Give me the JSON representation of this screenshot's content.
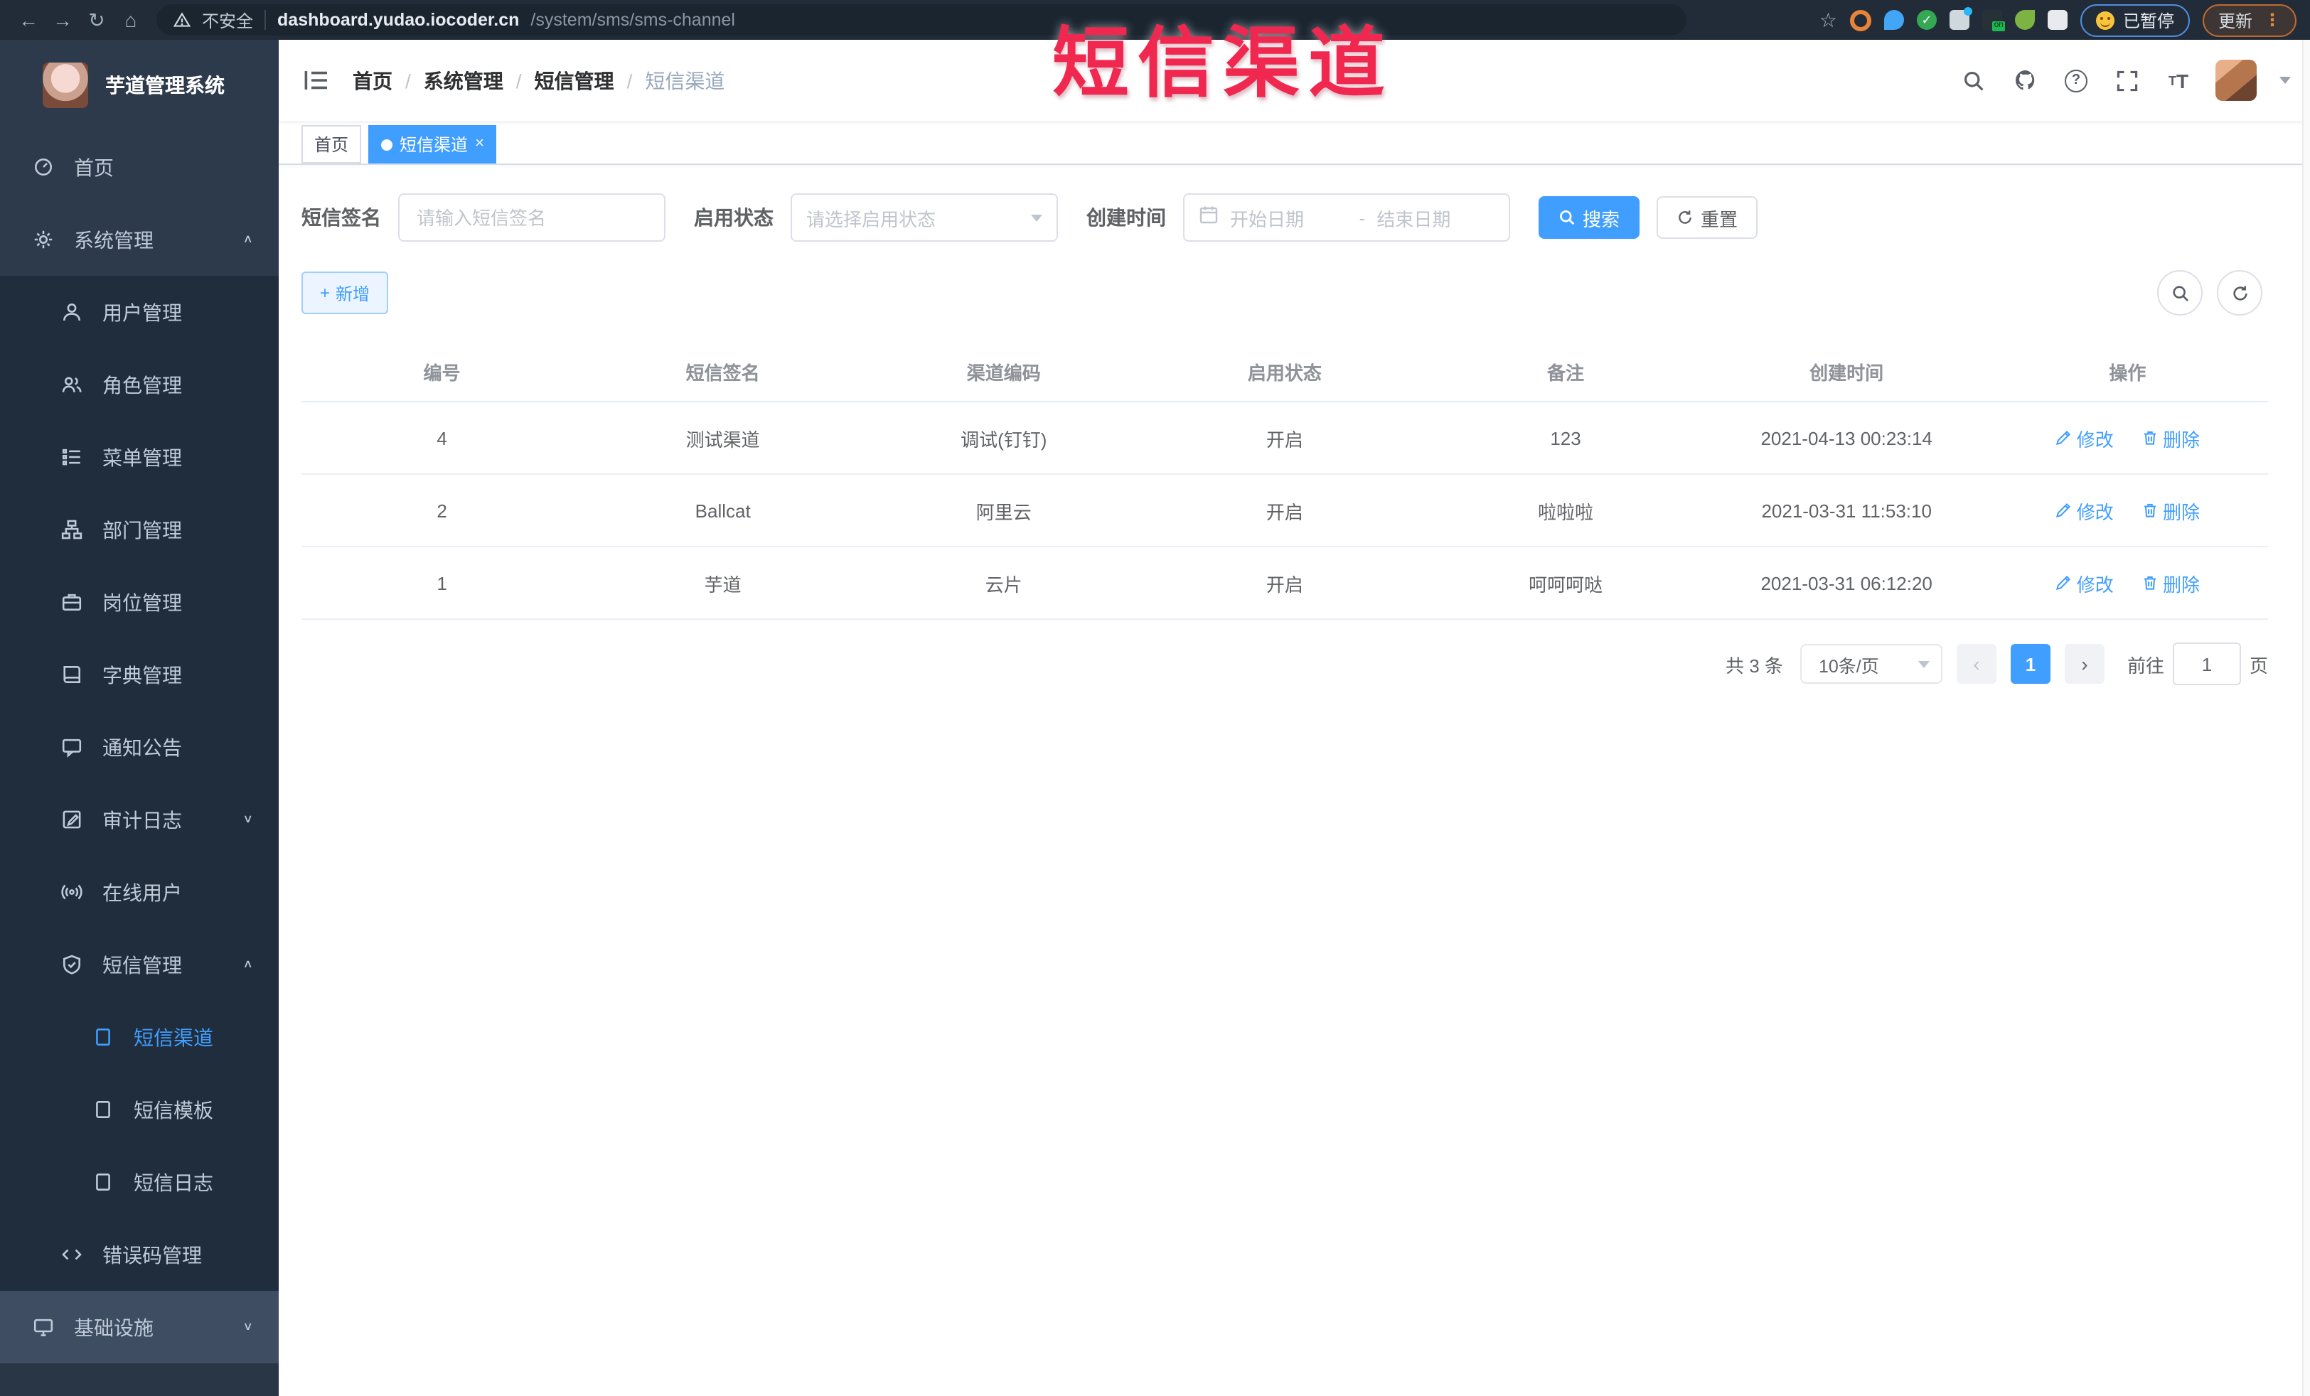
{
  "colors": {
    "accent": "#409eff",
    "overlay": "#f0284f",
    "sidebar": "#2d3a4b",
    "submenu": "#1f2d3d",
    "sidebartext": "#bfcbd9"
  },
  "browser": {
    "security_label": "不安全",
    "url_host": "dashboard.yudao.iocoder.cn",
    "url_path": "/system/sms/sms-channel",
    "paused_badge": "已暂停",
    "update_label": "更新",
    "nav_icons": [
      "back-icon",
      "forward-icon",
      "refresh-icon",
      "home-icon"
    ],
    "extension_icons": [
      "bookmark-star-icon",
      "orange-extension-icon",
      "pin-extension-icon",
      "check-extension-icon",
      "people-extension-icon",
      "dark-on-extension-icon",
      "sprout-extension-icon",
      "puzzle-extension-icon"
    ]
  },
  "overlay": {
    "text": "短信渠道"
  },
  "sidebar": {
    "title": "芋道管理系统",
    "items": [
      {
        "id": "home",
        "label": "首页",
        "icon": "dashboard-icon",
        "level": 1
      },
      {
        "id": "system",
        "label": "系统管理",
        "icon": "gear-icon",
        "level": 1,
        "arrow": "up"
      },
      {
        "id": "users",
        "label": "用户管理",
        "icon": "user-icon",
        "level": 2
      },
      {
        "id": "roles",
        "label": "角色管理",
        "icon": "users-icon",
        "level": 2
      },
      {
        "id": "menus",
        "label": "菜单管理",
        "icon": "menu-list-icon",
        "level": 2
      },
      {
        "id": "depts",
        "label": "部门管理",
        "icon": "tree-icon",
        "level": 2
      },
      {
        "id": "posts",
        "label": "岗位管理",
        "icon": "briefcase-icon",
        "level": 2
      },
      {
        "id": "dicts",
        "label": "字典管理",
        "icon": "book-icon",
        "level": 2
      },
      {
        "id": "notices",
        "label": "通知公告",
        "icon": "message-icon",
        "level": 2
      },
      {
        "id": "auditlog",
        "label": "审计日志",
        "icon": "log-icon",
        "level": 2,
        "arrow": "down"
      },
      {
        "id": "online",
        "label": "在线用户",
        "icon": "online-icon",
        "level": 2
      },
      {
        "id": "sms",
        "label": "短信管理",
        "icon": "shield-icon",
        "level": 2,
        "arrow": "up"
      },
      {
        "id": "sms-channel",
        "label": "短信渠道",
        "icon": "doc-icon",
        "level": 3,
        "active": true
      },
      {
        "id": "sms-template",
        "label": "短信模板",
        "icon": "doc-icon",
        "level": 3
      },
      {
        "id": "sms-log",
        "label": "短信日志",
        "icon": "doc-icon",
        "level": 3
      },
      {
        "id": "errcode",
        "label": "错误码管理",
        "icon": "code-icon",
        "level": 2
      },
      {
        "id": "infra",
        "label": "基础设施",
        "icon": "infra-icon",
        "level": 1,
        "arrow": "down",
        "variant": "light"
      }
    ]
  },
  "header": {
    "breadcrumb": [
      "首页",
      "系统管理",
      "短信管理",
      "短信渠道"
    ],
    "breadcrumb_separator": "/",
    "icons": [
      "search-icon",
      "github-icon",
      "help-icon",
      "fullscreen-icon",
      "font-size-icon",
      "avatar",
      "caret-down-icon"
    ]
  },
  "tabs": [
    {
      "label": "首页",
      "active": false
    },
    {
      "label": "短信渠道",
      "active": true,
      "close": "×"
    }
  ],
  "filters": {
    "sign_label": "短信签名",
    "sign_placeholder": "请输入短信签名",
    "status_label": "启用状态",
    "status_placeholder": "请选择启用状态",
    "time_label": "创建时间",
    "start_placeholder": "开始日期",
    "range_separator": "-",
    "end_placeholder": "结束日期",
    "search_label": "搜索",
    "reset_label": "重置"
  },
  "toolbar": {
    "add_label": "新增",
    "plus_glyph": "+"
  },
  "table": {
    "columns": [
      "编号",
      "短信签名",
      "渠道编码",
      "启用状态",
      "备注",
      "创建时间",
      "操作"
    ],
    "rows": [
      {
        "id": "4",
        "sign": "测试渠道",
        "code": "调试(钉钉)",
        "status": "开启",
        "remark": "123",
        "created": "2021-04-13 00:23:14"
      },
      {
        "id": "2",
        "sign": "Ballcat",
        "code": "阿里云",
        "status": "开启",
        "remark": "啦啦啦",
        "created": "2021-03-31 11:53:10"
      },
      {
        "id": "1",
        "sign": "芋道",
        "code": "云片",
        "status": "开启",
        "remark": "呵呵呵哒",
        "created": "2021-03-31 06:12:20"
      }
    ],
    "edit_label": "修改",
    "delete_label": "删除"
  },
  "pagination": {
    "total_label": "共 3 条",
    "page_size": "10条/页",
    "prev_glyph": "‹",
    "next_glyph": "›",
    "current_page": "1",
    "goto_label": "前往",
    "goto_value": "1",
    "page_suffix": "页"
  }
}
